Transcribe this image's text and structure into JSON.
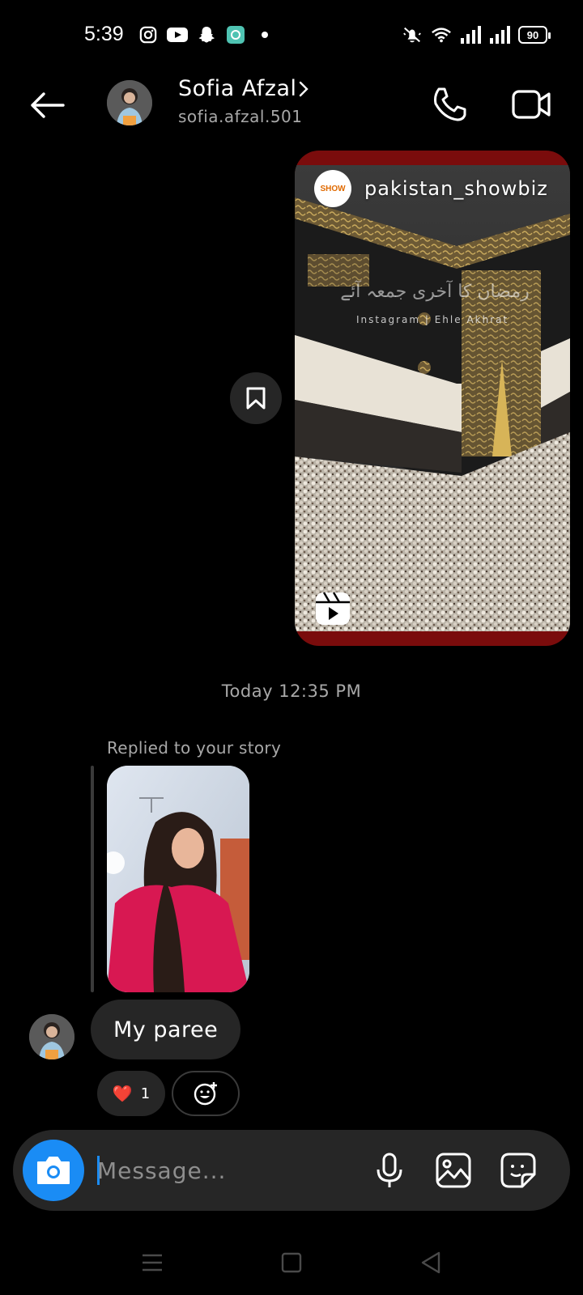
{
  "status_bar": {
    "time": "5:39",
    "battery": "90",
    "icons_left": [
      "instagram-icon",
      "youtube-icon",
      "snapchat-icon",
      "app-icon",
      "dot-icon"
    ],
    "icons_right": [
      "mute-icon",
      "wifi-icon",
      "signal-icon",
      "signal-icon",
      "battery-icon"
    ]
  },
  "header": {
    "name": "Sofia Afzal",
    "username": "sofia.afzal.501"
  },
  "shared_reel": {
    "author": "pakistan_showbiz",
    "author_avatar_text": "SHOW",
    "caption": "رمضان کا آخری جمعہ آئے",
    "watermark": "Instagram | Ehle Akhrat"
  },
  "timestamp": "Today 12:35 PM",
  "story_reply": {
    "label": "Replied to your story",
    "message": "My paree",
    "reaction_emoji": "❤️",
    "reaction_count": "1"
  },
  "composer": {
    "placeholder": "Message..."
  },
  "colors": {
    "accent": "#1a8cf5",
    "bubble": "#262626",
    "background": "#000000",
    "muted_text": "#a8a8a8"
  }
}
